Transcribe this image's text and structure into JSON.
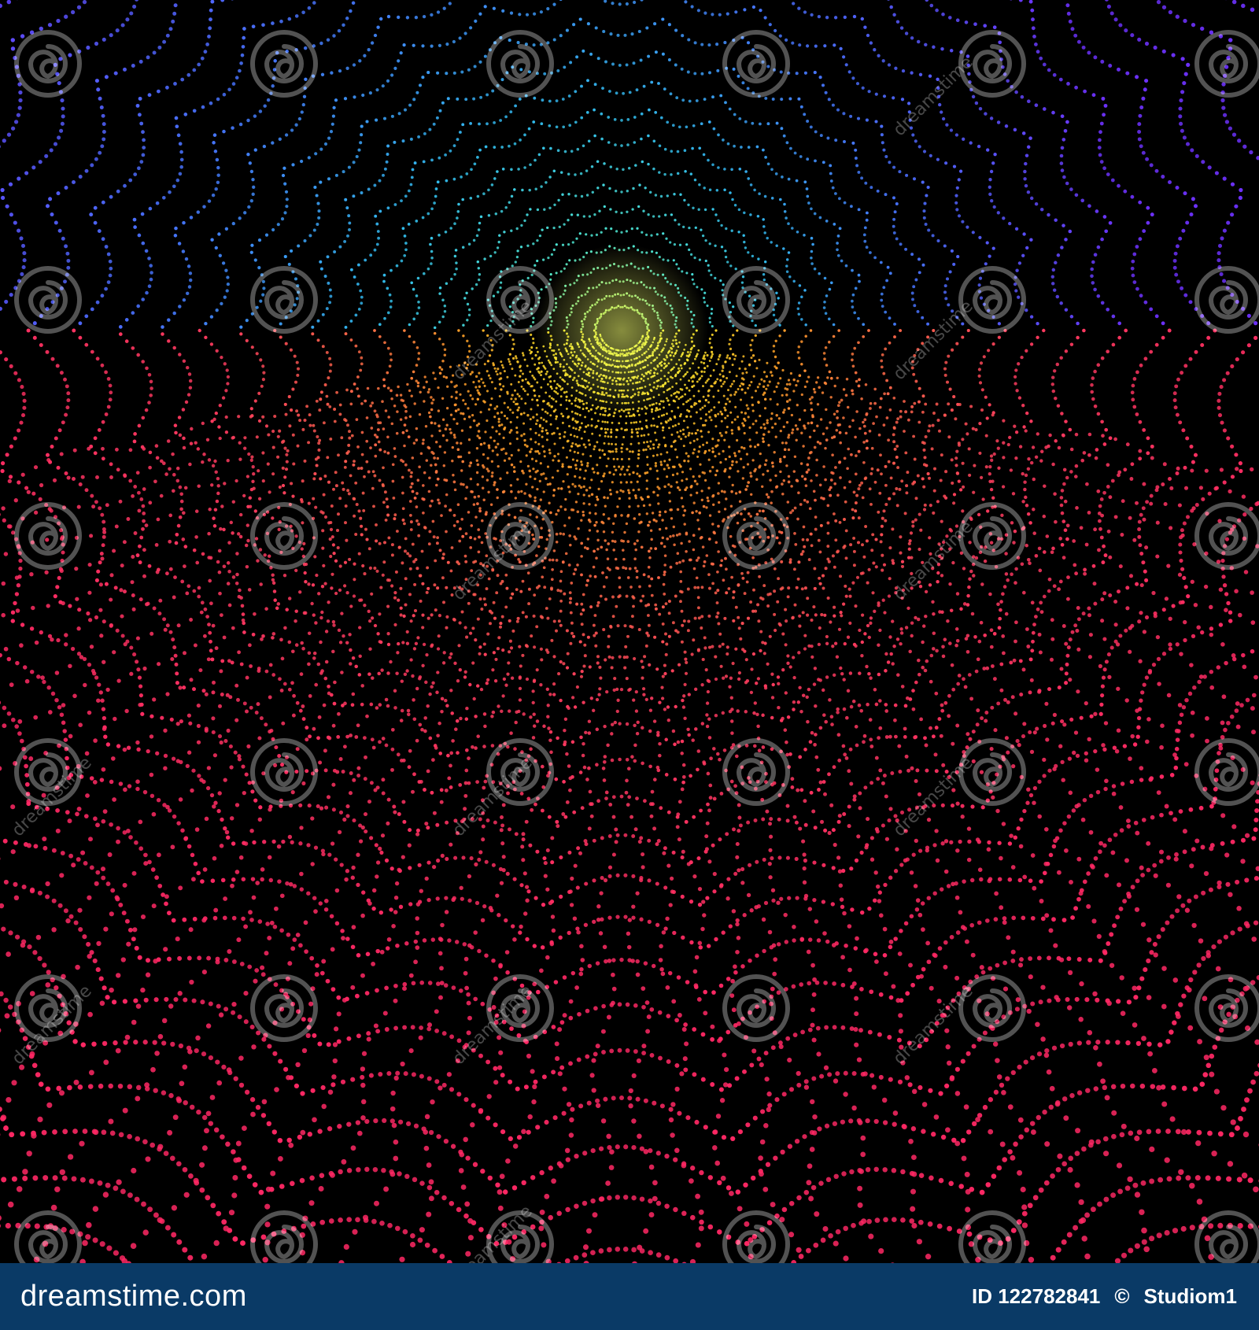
{
  "image": {
    "description_colors": {
      "background": "#000000",
      "palette": [
        "#6a2cff",
        "#3d7bff",
        "#2fd4e8",
        "#b8f03a",
        "#ffd21f",
        "#ff8a2a",
        "#ff4a5a",
        "#ff2e6e"
      ]
    },
    "icons": [
      "dreamstime-spiral-watermark-icon"
    ]
  },
  "watermark": {
    "text": "dreamstime"
  },
  "footer": {
    "brand": "dreamstime.com",
    "id_label": "ID 122782841",
    "separator": "©",
    "author": "Studiom1",
    "background": "#0a3a66"
  }
}
